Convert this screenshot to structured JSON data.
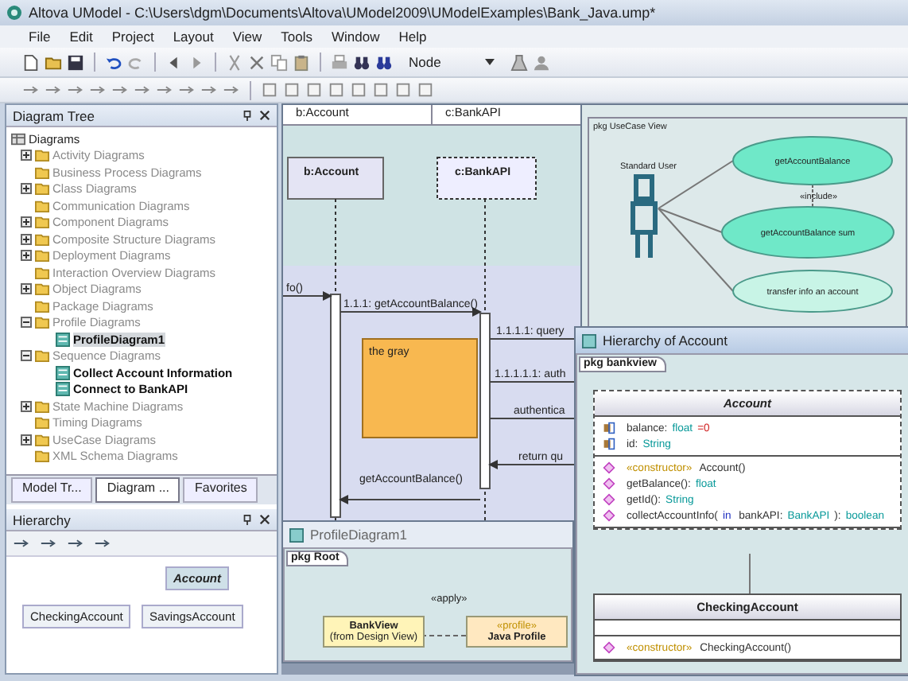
{
  "window": {
    "title": "Altova UModel - C:\\Users\\dgm\\Documents\\Altova\\UModel2009\\UModelExamples\\Bank_Java.ump*"
  },
  "menu": [
    "File",
    "Edit",
    "Project",
    "Layout",
    "View",
    "Tools",
    "Window",
    "Help"
  ],
  "toolbar": {
    "view_select": "Node"
  },
  "diagram_tree": {
    "title": "Diagram Tree",
    "items": [
      {
        "label": "Diagrams",
        "children": [
          {
            "label": "Activity Diagrams",
            "expanded": false
          },
          {
            "label": "Business Process Diagrams"
          },
          {
            "label": "Class Diagrams",
            "expanded": false
          },
          {
            "label": "Communication Diagrams"
          },
          {
            "label": "Component Diagrams",
            "expanded": false
          },
          {
            "label": "Composite Structure Diagrams",
            "expanded": false
          },
          {
            "label": "Deployment Diagrams",
            "expanded": false
          },
          {
            "label": "Interaction Overview Diagrams"
          },
          {
            "label": "Object Diagrams",
            "expanded": false
          },
          {
            "label": "Package Diagrams"
          },
          {
            "label": "Profile Diagrams",
            "expanded": true,
            "children": [
              {
                "label": "ProfileDiagram1",
                "selected": true
              }
            ]
          },
          {
            "label": "Sequence Diagrams",
            "expanded": true,
            "children": [
              {
                "label": "Collect Account Information",
                "selected": false
              },
              {
                "label": "Connect to BankAPI",
                "selected": false
              }
            ]
          },
          {
            "label": "State Machine Diagrams",
            "expanded": false
          },
          {
            "label": "Timing Diagrams"
          },
          {
            "label": "UseCase Diagrams",
            "expanded": false
          },
          {
            "label": "XML Schema Diagrams"
          }
        ]
      }
    ]
  },
  "panel_tabs": [
    {
      "label": "Model Tr...",
      "selected": false
    },
    {
      "label": "Diagram ...",
      "selected": true
    },
    {
      "label": "Favorites",
      "selected": false
    }
  ],
  "hierarchy_panel": {
    "title": "Hierarchy",
    "classes": [
      {
        "name": "Account",
        "abstract": true
      },
      {
        "name": "CheckingAccount",
        "abstract": false
      },
      {
        "name": "SavingsAccount",
        "abstract": false
      }
    ]
  },
  "sequence_diagram": {
    "columns": [
      "b:Account",
      "c:BankAPI"
    ],
    "lifelines": [
      "b:Account",
      "c:BankAPI"
    ],
    "messages": [
      "fo()",
      "1.1.1: getAccountBalance()",
      "1.1.1.1: query",
      "1.1.1.1.1: auth",
      "authentica",
      "return qu",
      "getAccountBalance()"
    ],
    "note": "the gray"
  },
  "usecase_diagram": {
    "package": "pkg UseCase View",
    "actor": "Standard User",
    "use_cases": [
      "getAccountBalance",
      "getAccountBalance sum",
      "transfer info an account"
    ],
    "relation": "«include»"
  },
  "class_window": {
    "title": "Hierarchy of Account",
    "package": "pkg bankview",
    "classes": [
      {
        "name": "Account",
        "abstract": true,
        "attributes": [
          [
            {
              "text": "balance:",
              "kind": "plain"
            },
            {
              "text": "float",
              "kind": "type"
            },
            {
              "text": "=0",
              "kind": "value"
            }
          ],
          [
            {
              "text": "id:",
              "kind": "plain"
            },
            {
              "text": "String",
              "kind": "type"
            }
          ]
        ],
        "operations": [
          [
            {
              "text": "«constructor»",
              "kind": "stereotype"
            },
            {
              "text": " Account()",
              "kind": "plain"
            }
          ],
          [
            {
              "text": "getBalance():",
              "kind": "plain"
            },
            {
              "text": "float",
              "kind": "type"
            }
          ],
          [
            {
              "text": "getId():",
              "kind": "plain"
            },
            {
              "text": "String",
              "kind": "type"
            }
          ],
          [
            {
              "text": "collectAccountInfo(",
              "kind": "plain"
            },
            {
              "text": "in",
              "kind": "keyword"
            },
            {
              "text": " bankAPI:",
              "kind": "plain"
            },
            {
              "text": "BankAPI",
              "kind": "type"
            },
            {
              "text": "):",
              "kind": "plain"
            },
            {
              "text": "boolean",
              "kind": "type"
            }
          ]
        ]
      },
      {
        "name": "CheckingAccount",
        "abstract": false,
        "operations": [
          [
            {
              "text": "«constructor»",
              "kind": "stereotype"
            },
            {
              "text": " CheckingAccount()",
              "kind": "plain"
            }
          ]
        ]
      }
    ]
  },
  "profile_window": {
    "title": "ProfileDiagram1",
    "package": "pkg Root",
    "relation": "«apply»",
    "packages": [
      {
        "name": "BankView",
        "note": "(from Design View)",
        "kind": "package"
      },
      {
        "name": "Java Profile",
        "note": "«profile»",
        "kind": "profile"
      }
    ]
  }
}
